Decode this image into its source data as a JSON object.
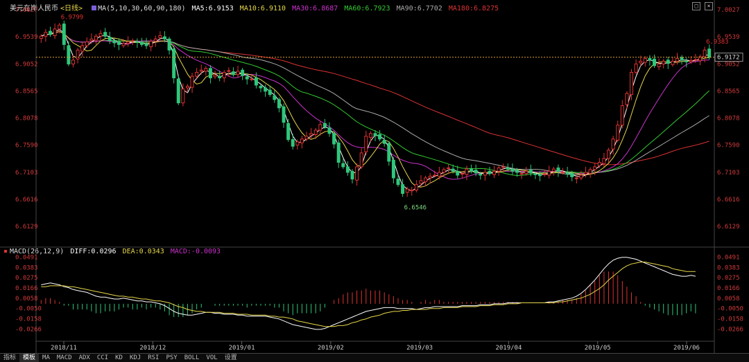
{
  "main_legend": {
    "title": "美元在岸人民币",
    "period": "<日线>",
    "ma": "MA(5,10,30,60,90,180)",
    "ma5": "MA5:6.9153",
    "ma10": "MA10:6.9110",
    "ma30": "MA30:6.8687",
    "ma60": "MA60:6.7923",
    "ma90": "MA90:6.7702",
    "ma180": "MA180:6.8275"
  },
  "macd_legend": {
    "name": "MACD(26,12,9)",
    "diff": "DIFF:0.0296",
    "dea": "DEA:0.0343",
    "macd": "MACD:-0.0093"
  },
  "current_price_tag": "6.9172",
  "tabs": [
    "指标",
    "模板",
    "MA",
    "MACD",
    "ADX",
    "CCI",
    "KD",
    "KDJ",
    "RSI",
    "PSY",
    "BOLL",
    "VOL",
    "设置"
  ],
  "colors": {
    "up": "#e03232",
    "down": "#2ec77a",
    "ma5": "#ffffff",
    "ma10": "#e8d84a",
    "ma30": "#cc33cc",
    "ma60": "#33cc33",
    "ma90": "#aaaaaa",
    "ma180": "#dd3333",
    "axis": "#d03a3a",
    "grid": "#333333"
  },
  "chart_data": [
    {
      "type": "candlestick",
      "title": "美元在岸人民币 <日线>",
      "x_labels": [
        "2018/11",
        "2018/12",
        "2019/01",
        "2019/02",
        "2019/03",
        "2019/04",
        "2019/05",
        "2019/06"
      ],
      "y_ticks": [
        "7.0027",
        "6.9539",
        "6.9052",
        "6.8565",
        "6.8078",
        "6.7590",
        "6.7103",
        "6.6616",
        "6.6129"
      ],
      "ylim": [
        6.578,
        7.0027
      ],
      "annotations": [
        {
          "text": "6.9799",
          "note": "high"
        },
        {
          "text": "6.6546",
          "note": "low"
        },
        {
          "text": "6.9383",
          "note": "recent high"
        }
      ],
      "last_close": 6.9172,
      "series": [
        {
          "name": "MA5",
          "last": 6.9153
        },
        {
          "name": "MA10",
          "last": 6.911
        },
        {
          "name": "MA30",
          "last": 6.8687
        },
        {
          "name": "MA60",
          "last": 6.7923
        },
        {
          "name": "MA90",
          "last": 6.7702
        },
        {
          "name": "MA180",
          "last": 6.8275
        }
      ],
      "close": [
        6.955,
        6.962,
        6.958,
        6.968,
        6.975,
        6.94,
        6.905,
        6.912,
        6.93,
        6.938,
        6.945,
        6.95,
        6.955,
        6.96,
        6.955,
        6.947,
        6.943,
        6.94,
        6.942,
        6.945,
        6.947,
        6.944,
        6.94,
        6.938,
        6.946,
        6.95,
        6.956,
        6.95,
        6.93,
        6.88,
        6.835,
        6.86,
        6.865,
        6.883,
        6.89,
        6.894,
        6.897,
        6.88,
        6.885,
        6.88,
        6.89,
        6.893,
        6.886,
        6.892,
        6.884,
        6.878,
        6.878,
        6.867,
        6.862,
        6.856,
        6.85,
        6.841,
        6.826,
        6.8,
        6.769,
        6.757,
        6.765,
        6.77,
        6.775,
        6.78,
        6.786,
        6.796,
        6.792,
        6.78,
        6.761,
        6.728,
        6.72,
        6.71,
        6.698,
        6.72,
        6.745,
        6.775,
        6.78,
        6.776,
        6.77,
        6.762,
        6.73,
        6.7,
        6.688,
        6.672,
        6.68,
        6.678,
        6.688,
        6.695,
        6.7,
        6.703,
        6.705,
        6.71,
        6.715,
        6.718,
        6.712,
        6.705,
        6.708,
        6.716,
        6.712,
        6.709,
        6.705,
        6.71,
        6.708,
        6.712,
        6.718,
        6.72,
        6.716,
        6.712,
        6.71,
        6.708,
        6.712,
        6.709,
        6.706,
        6.704,
        6.707,
        6.712,
        6.716,
        6.712,
        6.71,
        6.707,
        6.702,
        6.7,
        6.705,
        6.71,
        6.715,
        6.72,
        6.728,
        6.735,
        6.75,
        6.77,
        6.795,
        6.83,
        6.852,
        6.89,
        6.905,
        6.91,
        6.915,
        6.912,
        6.902,
        6.905,
        6.91,
        6.906,
        6.91,
        6.915,
        6.912,
        6.909,
        6.911,
        6.913,
        6.918,
        6.93,
        6.917
      ]
    },
    {
      "type": "macd",
      "title": "MACD(26,12,9)",
      "y_ticks": [
        "0.0491",
        "0.0383",
        "0.0275",
        "0.0166",
        "0.0058",
        "-0.0050",
        "-0.0158",
        "-0.0266"
      ],
      "ylim": [
        -0.03,
        0.051
      ],
      "series": [
        {
          "name": "DIFF",
          "last": 0.0296
        },
        {
          "name": "DEA",
          "last": 0.0343
        },
        {
          "name": "MACD",
          "last": -0.0093
        }
      ],
      "diff": [
        0.02,
        0.021,
        0.022,
        0.021,
        0.02,
        0.018,
        0.017,
        0.015,
        0.014,
        0.013,
        0.012,
        0.01,
        0.008,
        0.007,
        0.007,
        0.006,
        0.005,
        0.005,
        0.006,
        0.005,
        0.004,
        0.003,
        0.003,
        0.002,
        0.002,
        0.001,
        0.0,
        -0.002,
        -0.005,
        -0.008,
        -0.01,
        -0.011,
        -0.012,
        -0.012,
        -0.011,
        -0.01,
        -0.009,
        -0.009,
        -0.01,
        -0.01,
        -0.011,
        -0.011,
        -0.011,
        -0.012,
        -0.012,
        -0.013,
        -0.013,
        -0.013,
        -0.013,
        -0.013,
        -0.014,
        -0.015,
        -0.016,
        -0.018,
        -0.02,
        -0.022,
        -0.023,
        -0.024,
        -0.025,
        -0.026,
        -0.027,
        -0.027,
        -0.026,
        -0.024,
        -0.022,
        -0.02,
        -0.018,
        -0.016,
        -0.014,
        -0.012,
        -0.01,
        -0.008,
        -0.007,
        -0.006,
        -0.005,
        -0.004,
        -0.004,
        -0.004,
        -0.005,
        -0.005,
        -0.005,
        -0.005,
        -0.006,
        -0.005,
        -0.004,
        -0.004,
        -0.003,
        -0.003,
        -0.003,
        -0.003,
        -0.003,
        -0.003,
        -0.002,
        -0.002,
        -0.002,
        -0.002,
        -0.001,
        -0.001,
        -0.001,
        -0.0,
        0.0,
        0.0,
        0.001,
        0.001,
        0.001,
        0.001,
        0.001,
        0.001,
        0.001,
        0.001,
        0.001,
        0.002,
        0.002,
        0.003,
        0.004,
        0.005,
        0.006,
        0.008,
        0.011,
        0.015,
        0.02,
        0.025,
        0.031,
        0.037,
        0.042,
        0.046,
        0.048,
        0.049,
        0.049,
        0.048,
        0.047,
        0.045,
        0.043,
        0.041,
        0.039,
        0.037,
        0.035,
        0.033,
        0.031,
        0.03,
        0.029,
        0.029,
        0.03,
        0.029
      ],
      "dea": [
        0.018,
        0.018,
        0.019,
        0.019,
        0.019,
        0.019,
        0.018,
        0.018,
        0.017,
        0.016,
        0.015,
        0.014,
        0.013,
        0.012,
        0.011,
        0.01,
        0.009,
        0.008,
        0.008,
        0.007,
        0.007,
        0.006,
        0.005,
        0.005,
        0.004,
        0.003,
        0.003,
        0.002,
        0.001,
        -0.001,
        -0.003,
        -0.004,
        -0.006,
        -0.007,
        -0.008,
        -0.008,
        -0.009,
        -0.009,
        -0.009,
        -0.009,
        -0.01,
        -0.01,
        -0.01,
        -0.011,
        -0.011,
        -0.011,
        -0.012,
        -0.012,
        -0.012,
        -0.012,
        -0.013,
        -0.013,
        -0.014,
        -0.014,
        -0.015,
        -0.016,
        -0.018,
        -0.019,
        -0.02,
        -0.021,
        -0.022,
        -0.023,
        -0.024,
        -0.024,
        -0.024,
        -0.023,
        -0.023,
        -0.022,
        -0.02,
        -0.019,
        -0.017,
        -0.016,
        -0.014,
        -0.013,
        -0.012,
        -0.01,
        -0.009,
        -0.008,
        -0.008,
        -0.007,
        -0.007,
        -0.006,
        -0.006,
        -0.006,
        -0.006,
        -0.005,
        -0.005,
        -0.005,
        -0.004,
        -0.004,
        -0.004,
        -0.004,
        -0.003,
        -0.003,
        -0.003,
        -0.003,
        -0.002,
        -0.002,
        -0.002,
        -0.001,
        -0.001,
        -0.001,
        -0.0,
        0.0,
        0.0,
        0.001,
        0.001,
        0.001,
        0.001,
        0.001,
        0.001,
        0.001,
        0.001,
        0.002,
        0.002,
        0.003,
        0.004,
        0.005,
        0.006,
        0.008,
        0.01,
        0.013,
        0.016,
        0.02,
        0.025,
        0.029,
        0.033,
        0.037,
        0.04,
        0.042,
        0.043,
        0.044,
        0.044,
        0.043,
        0.042,
        0.041,
        0.04,
        0.039,
        0.037,
        0.036,
        0.035,
        0.034,
        0.034,
        0.034
      ]
    }
  ]
}
